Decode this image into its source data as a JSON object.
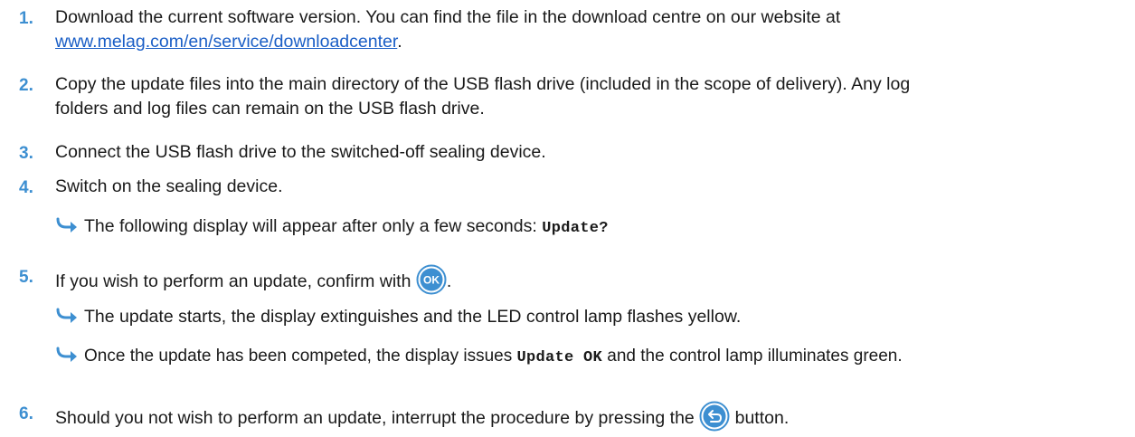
{
  "steps": [
    {
      "number": "1.",
      "text_before": "Download the current software version. You can find the file in the download centre on our website at ",
      "link_text": "www.melag.com/en/service/downloadcenter",
      "text_after": "."
    },
    {
      "number": "2.",
      "line1": "Copy the update files into the main directory of the USB flash drive (included in the scope of delivery). Any log",
      "line2": "folders and log files can remain on the USB flash drive."
    },
    {
      "number": "3.",
      "text": "Connect the USB flash drive to the switched-off sealing device."
    },
    {
      "number": "4.",
      "text": "Switch on the sealing device.",
      "result": {
        "text": "The following display will appear after only a few seconds: ",
        "display": "Update?"
      }
    },
    {
      "number": "5.",
      "text_before": "If you wish to perform an update, confirm with ",
      "button_label": "OK",
      "text_after": ".",
      "results": [
        {
          "text": "The update starts, the display extinguishes and the LED control lamp flashes yellow."
        },
        {
          "text_before": "Once the update has been competed, the display issues ",
          "display": "Update OK",
          "text_after": " and the control lamp illuminates green."
        }
      ]
    },
    {
      "number": "6.",
      "text_before": "Should you not wish to perform an update, interrupt the procedure by pressing the ",
      "text_after": " button."
    }
  ],
  "colors": {
    "accent": "#3d8fd1",
    "link": "#1a5ec6",
    "text": "#1a1a1a"
  },
  "icons": {
    "ok_button": "ok-button-icon",
    "back_button": "back-button-icon",
    "result_arrow": "result-arrow-icon"
  }
}
